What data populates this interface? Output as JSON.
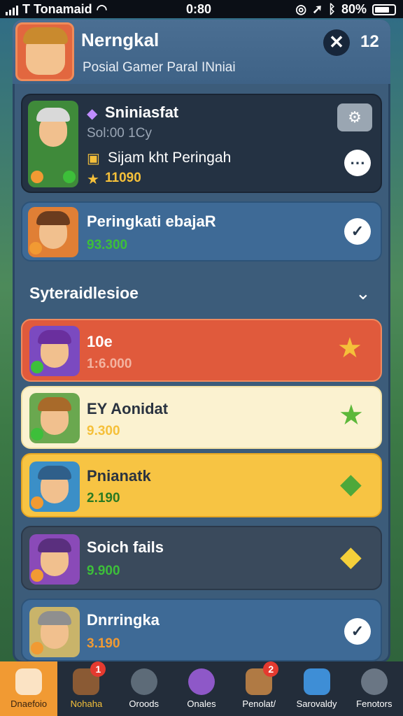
{
  "status": {
    "carrier": "T Tonamaid",
    "time": "0:80",
    "battery": "80%"
  },
  "header": {
    "title": "Nerngkal",
    "subtitle": "Posial Gamer Paral INniai",
    "close_label": "✕",
    "count": "12"
  },
  "featured": {
    "name": "Sniniasfat",
    "meta": "Sol:00 1Cy",
    "title_line": "Sijam kht Peringah",
    "score": "11090",
    "gear": "⚙",
    "more": "⋯"
  },
  "ranking": {
    "name": "Peringkati ebajaR",
    "score": "93.300",
    "action": "✓"
  },
  "section": {
    "title": "Syteraidlesioe",
    "chevron": "⌄"
  },
  "players": [
    {
      "name": "10e",
      "score": "1:6.000",
      "icon": "★"
    },
    {
      "name": "EY Aonidat",
      "score": "9.300",
      "icon": "★"
    },
    {
      "name": "Pnianatk",
      "score": "2.190",
      "icon": "◆"
    },
    {
      "name": "Soich fails",
      "score": "9.900",
      "icon": "◆"
    },
    {
      "name": "Dnrringka",
      "score": "3.190",
      "icon": "✓"
    }
  ],
  "tabs": [
    {
      "label": "Dnaefoio"
    },
    {
      "label": "Nohaha",
      "badge": "1"
    },
    {
      "label": "Oroods"
    },
    {
      "label": "Onales"
    },
    {
      "label": "Penolat/",
      "badge": "2"
    },
    {
      "label": "Sarovaldy"
    },
    {
      "label": "Fenotors"
    }
  ],
  "colors": {
    "accent": "#f19a33",
    "card_red": "#e05a3c",
    "card_cream": "#fbf2d0",
    "card_yellow": "#f7c443",
    "card_dark": "#243243",
    "score_green": "#3dbf3a",
    "score_gold": "#f5c03a"
  }
}
